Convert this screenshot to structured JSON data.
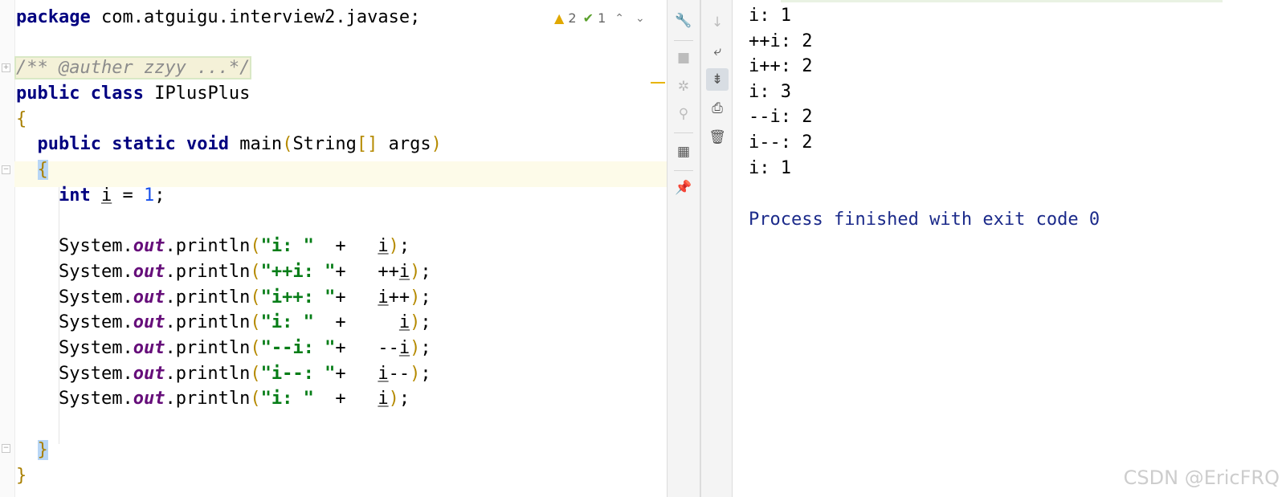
{
  "editor": {
    "line_package_kw": "package",
    "line_package_name": " com.atguigu.interview2.javase;",
    "doc_comment": "/** @auther zzyy ...*/",
    "class_mod": "public",
    "class_kw": "class",
    "class_name": " IPlusPlus",
    "open_brace": "{",
    "close_brace": "}",
    "main_public": "public",
    "main_static": "static",
    "main_void": "void",
    "main_name": " main",
    "main_param_type": "String",
    "main_param_arr": "[]",
    "main_param_name": " args",
    "int_kw": "int",
    "var_i": "i",
    "assign": " = ",
    "one": "1",
    "semi": ";",
    "sys": "System.",
    "out": "out",
    "println": ".println",
    "prints": [
      {
        "str": "\"i: \"",
        "pad": "  +   ",
        "pre": "",
        "var": "i",
        "post": ""
      },
      {
        "str": "\"++i: \"",
        "pad": "+   ",
        "pre": "++",
        "var": "i",
        "post": ""
      },
      {
        "str": "\"i++: \"",
        "pad": "+   ",
        "pre": "",
        "var": "i",
        "post": "++"
      },
      {
        "str": "\"i: \"",
        "pad": "  +     ",
        "pre": "",
        "var": "i",
        "post": ""
      },
      {
        "str": "\"--i: \"",
        "pad": "+   ",
        "pre": "--",
        "var": "i",
        "post": ""
      },
      {
        "str": "\"i--: \"",
        "pad": "+   ",
        "pre": "",
        "var": "i",
        "post": "--"
      },
      {
        "str": "\"i: \"",
        "pad": "  +   ",
        "pre": "",
        "var": "i",
        "post": ""
      }
    ],
    "warnings_count": "2",
    "ok_count": "1"
  },
  "icons": {
    "warning": "warning-icon",
    "ok": "check-icon",
    "wrench": "wrench-icon",
    "stop": "stop-icon",
    "bug": "bug-icon",
    "pin": "pin-icon"
  },
  "console": {
    "lines": [
      "i: 1",
      "++i: 2",
      "i++: 2",
      "i: 3",
      "--i: 2",
      "i--: 2",
      "i: 1"
    ],
    "process": "Process finished with exit code 0"
  },
  "watermark": "CSDN @EricFRQ",
  "colors": {
    "keyword": "#000080",
    "string": "#067d17",
    "number": "#1750eb",
    "field": "#660e7a"
  }
}
